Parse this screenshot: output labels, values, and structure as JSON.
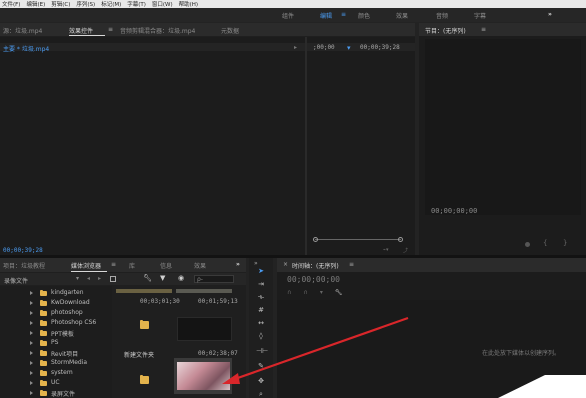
{
  "menu": [
    "文件(F)",
    "编辑(E)",
    "剪辑(C)",
    "序列(S)",
    "标记(M)",
    "字幕(T)",
    "窗口(W)",
    "帮助(H)"
  ],
  "workspaces": {
    "items": [
      "组件",
      "编辑",
      "颜色",
      "效果",
      "音频",
      "字幕"
    ],
    "active": "编辑",
    "more": "»"
  },
  "source_panel": {
    "tabs": [
      "源：垃圾.mp4",
      "效果控件",
      "音频剪辑混合器：垃圾.mp4",
      "元数据"
    ],
    "active_tab": "效果控件",
    "clip_label": "主要 * 垃圾.mp4",
    "timecode_start": ";00;00",
    "timecode_end": "00;00;39;28",
    "current_time": "00;00;39;28"
  },
  "program_panel": {
    "title": "节目：(无序列)",
    "timecode": "00;00;00;00"
  },
  "project_panel": {
    "tabs": [
      "项目：垃圾教程",
      "媒体浏览器",
      "库",
      "信息",
      "效果"
    ],
    "active_tab": "媒体浏览器",
    "more": "»",
    "location": "录像文件",
    "search_placeholder": "ρ-",
    "tree": [
      {
        "name": "kindgarten",
        "expanded": false
      },
      {
        "name": "KwDownload",
        "expanded": false
      },
      {
        "name": "photoshop",
        "expanded": false
      },
      {
        "name": "Photoshop CS6",
        "expanded": false
      },
      {
        "name": "PPT模板",
        "expanded": false
      },
      {
        "name": "PS",
        "expanded": false
      },
      {
        "name": "Revit项目",
        "expanded": false
      },
      {
        "name": "StormMedia",
        "expanded": false
      },
      {
        "name": "system",
        "expanded": false
      },
      {
        "name": "UC",
        "expanded": false
      },
      {
        "name": "录屏文件",
        "expanded": false
      }
    ],
    "thumbnails": [
      {
        "caption": "",
        "duration": "00;03;01;30"
      },
      {
        "caption": "",
        "duration": "00;01;59;13"
      },
      {
        "caption": "新建文件夹",
        "duration": ""
      },
      {
        "caption": "",
        "duration": "00;02;38;07"
      },
      {
        "caption": "",
        "duration": ""
      },
      {
        "caption": "",
        "duration": ""
      }
    ]
  },
  "tools": [
    "selection-tool",
    "track-select-tool",
    "ripple-edit-tool",
    "rolling-edit-tool",
    "rate-stretch-tool",
    "razor-tool",
    "slip-tool",
    "pen-tool",
    "hand-tool"
  ],
  "timeline": {
    "title": "时间轴：(无序列)",
    "timecode": "00;00;00;00",
    "empty_hint": "在此处放下媒体以创建序列。"
  },
  "colors": {
    "accent": "#4b9cf2",
    "panel": "#1f1f1f",
    "tabbar": "#2b2b2b",
    "arrow": "#d9262a"
  }
}
